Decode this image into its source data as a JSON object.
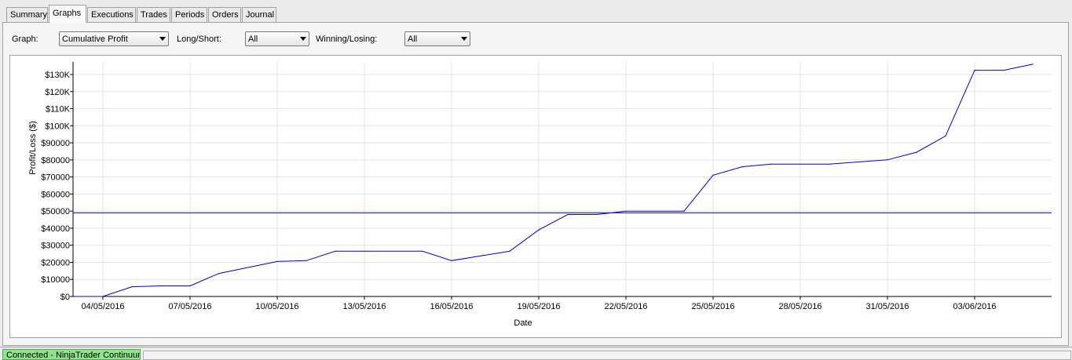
{
  "tabs": [
    {
      "label": "Summary",
      "active": false
    },
    {
      "label": "Graphs",
      "active": true
    },
    {
      "label": "Executions",
      "active": false
    },
    {
      "label": "Trades",
      "active": false
    },
    {
      "label": "Periods",
      "active": false
    },
    {
      "label": "Orders",
      "active": false
    },
    {
      "label": "Journal",
      "active": false
    }
  ],
  "controls": {
    "graph_label": "Graph:",
    "graph_value": "Cumulative Profit",
    "longshort_label": "Long/Short:",
    "longshort_value": "All",
    "winlose_label": "Winning/Losing:",
    "winlose_value": "All"
  },
  "status": {
    "connection": "Connected - NinjaTrader Continuum"
  },
  "colors": {
    "line": "#0000cc",
    "grid": "#e3e3e3",
    "status_ok": "#8ee58e"
  },
  "chart_data": {
    "type": "line",
    "xlabel": "Date",
    "ylabel": "Profit/Loss ($)",
    "ylim": [
      0,
      135000
    ],
    "grid": true,
    "x_ticks": [
      "04/05/2016",
      "07/05/2016",
      "10/05/2016",
      "13/05/2016",
      "16/05/2016",
      "19/05/2016",
      "22/05/2016",
      "25/05/2016",
      "28/05/2016",
      "31/05/2016",
      "03/06/2016"
    ],
    "y_ticks": [
      {
        "value": 0,
        "label": "$0"
      },
      {
        "value": 10000,
        "label": "$10000"
      },
      {
        "value": 20000,
        "label": "$20000"
      },
      {
        "value": 30000,
        "label": "$30000"
      },
      {
        "value": 40000,
        "label": "$40000"
      },
      {
        "value": 50000,
        "label": "$50000"
      },
      {
        "value": 60000,
        "label": "$60000"
      },
      {
        "value": 70000,
        "label": "$70000"
      },
      {
        "value": 80000,
        "label": "$80000"
      },
      {
        "value": 90000,
        "label": "$90000"
      },
      {
        "value": 100000,
        "label": "$100K"
      },
      {
        "value": 110000,
        "label": "$110K"
      },
      {
        "value": 120000,
        "label": "$120K"
      },
      {
        "value": 130000,
        "label": "$130K"
      }
    ],
    "series": [
      {
        "x": [
          "03/05/2016",
          "04/05/2016",
          "05/05/2016",
          "06/05/2016",
          "07/05/2016",
          "08/05/2016",
          "10/05/2016",
          "11/05/2016",
          "12/05/2016",
          "13/05/2016",
          "15/05/2016",
          "16/05/2016",
          "18/05/2016",
          "19/05/2016",
          "20/05/2016",
          "21/05/2016",
          "22/05/2016",
          "24/05/2016",
          "25/05/2016",
          "26/05/2016",
          "27/05/2016",
          "29/05/2016",
          "31/05/2016",
          "01/06/2016",
          "02/06/2016",
          "03/06/2016",
          "04/06/2016",
          "05/06/2016"
        ],
        "y": [
          0,
          0,
          5700,
          6200,
          6200,
          13500,
          20500,
          21000,
          26500,
          26500,
          26500,
          21000,
          26500,
          39000,
          48000,
          48000,
          50000,
          50000,
          71000,
          76000,
          77500,
          77500,
          80000,
          84500,
          94000,
          132500,
          132500,
          136000
        ]
      }
    ],
    "reference_line": {
      "y": 49000
    }
  }
}
